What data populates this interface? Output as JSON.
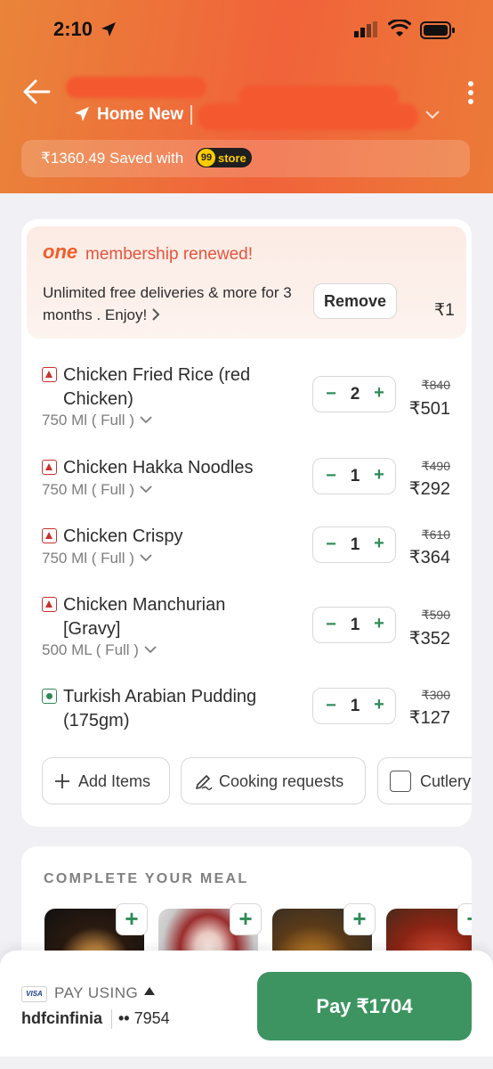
{
  "status_bar": {
    "time": "2:10"
  },
  "header": {
    "address_label": "Home New",
    "savings_text": "₹1360.49 Saved with",
    "store_badge_number": "99",
    "store_badge_word": "store"
  },
  "membership": {
    "logo": "one",
    "title": "membership renewed!",
    "description": "Unlimited free deliveries & more for 3 months . Enjoy!",
    "remove_label": "Remove",
    "price": "₹1"
  },
  "cart": {
    "items": [
      {
        "name": "Chicken Fried Rice (red Chicken)",
        "variant": "750 Ml ( Full )",
        "qty": "2",
        "old_price": "₹840",
        "new_price": "₹501",
        "type": "nonveg"
      },
      {
        "name": "Chicken Hakka Noodles",
        "variant": "750 Ml ( Full )",
        "qty": "1",
        "old_price": "₹490",
        "new_price": "₹292",
        "type": "nonveg"
      },
      {
        "name": "Chicken Crispy",
        "variant": "750 Ml ( Full )",
        "qty": "1",
        "old_price": "₹610",
        "new_price": "₹364",
        "type": "nonveg"
      },
      {
        "name": "Chicken Manchurian [Gravy]",
        "variant": "500 ML ( Full )",
        "qty": "1",
        "old_price": "₹590",
        "new_price": "₹352",
        "type": "nonveg"
      },
      {
        "name": "Turkish Arabian Pudding (175gm)",
        "variant": "",
        "qty": "1",
        "old_price": "₹300",
        "new_price": "₹127",
        "type": "veg"
      }
    ],
    "actions": {
      "add_items": "Add Items",
      "cooking_requests": "Cooking requests",
      "cutlery": "Cutlery"
    }
  },
  "meal": {
    "title": "COMPLETE YOUR MEAL"
  },
  "footer": {
    "card_brand": "VISA",
    "pay_using": "PAY USING",
    "card_name": "hdfcinfinia",
    "card_dots": "••",
    "card_last4": "7954",
    "pay_button": "Pay ₹1704"
  },
  "colors": {
    "accent_orange": "#f1633a",
    "pay_green": "#3d9461",
    "nonveg_red": "#c9302c",
    "veg_green": "#2e8b57"
  }
}
